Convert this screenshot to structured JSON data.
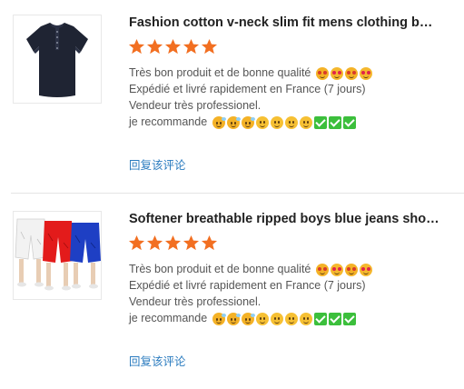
{
  "reviews": [
    {
      "product_title": "Fashion cotton v-neck slim fit mens clothing b…",
      "image_icon": "navy-polo-shirt",
      "rating": 5,
      "star_color": "#f26f21",
      "lines": [
        "Très  bon produit et de bonne qualité",
        "Expédié et livré rapidement en France (7 jours)",
        "Vendeur très professionel.",
        "je recommande"
      ],
      "line1_emojis": [
        "star-struck",
        "smiling-face-with-heart-eyes",
        "star-struck",
        "smiling-face-with-heart-eyes"
      ],
      "line4_emojis": [
        "hot-face",
        "hot-face",
        "hot-face",
        "slightly-smiling-face",
        "slightly-smiling-face",
        "slightly-smiling-face",
        "slightly-smiling-face",
        "check-mark-button",
        "check-mark-button",
        "check-mark-button"
      ],
      "reply_label": "回复该评论"
    },
    {
      "product_title": "Softener breathable ripped boys blue jeans sho…",
      "image_icon": "ripped-denim-shorts",
      "rating": 5,
      "star_color": "#f26f21",
      "lines": [
        "Très  bon produit et de bonne qualité",
        "Expédié et livré rapidement en France (7 jours)",
        "Vendeur très professionel.",
        "je recommande"
      ],
      "line1_emojis": [
        "star-struck",
        "smiling-face-with-heart-eyes",
        "star-struck",
        "smiling-face-with-heart-eyes"
      ],
      "line4_emojis": [
        "hot-face",
        "hot-face",
        "hot-face",
        "slightly-smiling-face",
        "slightly-smiling-face",
        "slightly-smiling-face",
        "slightly-smiling-face",
        "check-mark-button",
        "check-mark-button",
        "check-mark-button"
      ],
      "reply_label": "回复该评论"
    }
  ],
  "colors": {
    "link": "#2a7bbf",
    "star": "#f26f21",
    "title": "#222222",
    "text": "#555555",
    "divider": "#e5e5e5"
  }
}
